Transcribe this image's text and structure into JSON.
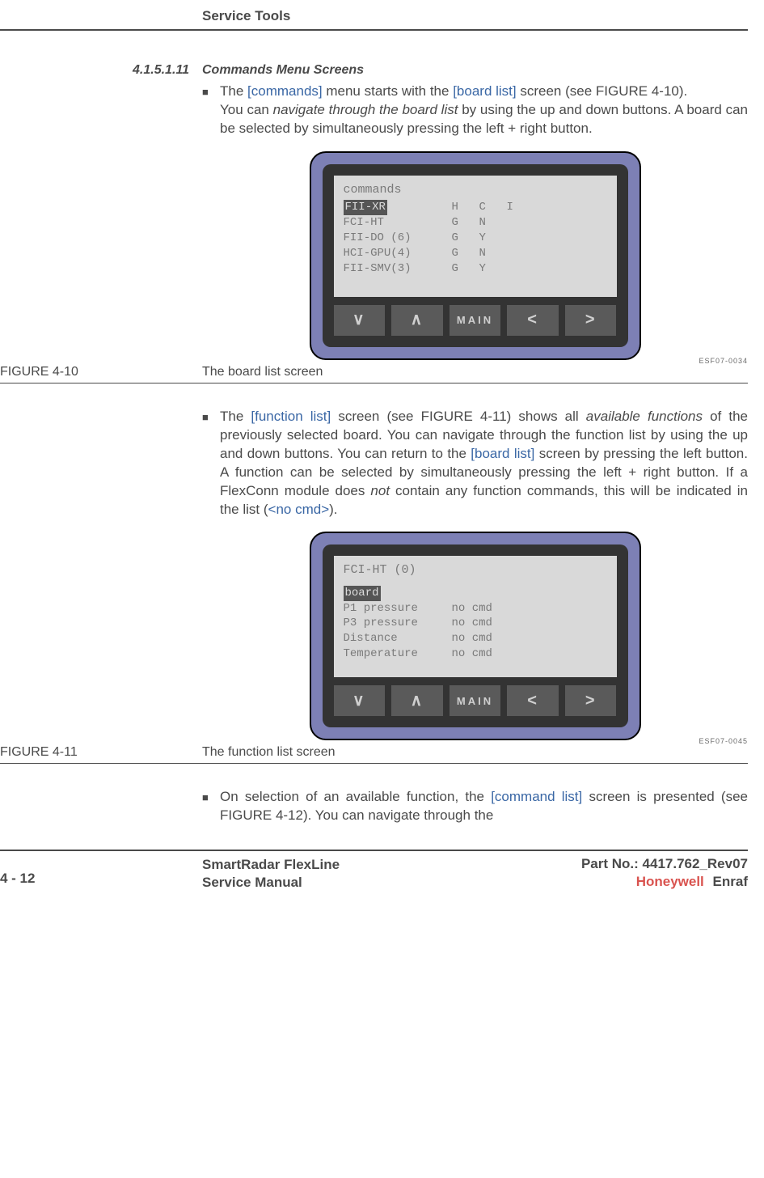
{
  "header": {
    "section": "Service Tools"
  },
  "section": {
    "number": "4.1.5.1.11",
    "title": "Commands Menu Screens"
  },
  "bullets": {
    "b1_pre": "The ",
    "b1_ref1": "[commands]",
    "b1_mid1": " menu starts with the ",
    "b1_ref2": "[board list]",
    "b1_mid2": " screen (see FIGURE 4-10).",
    "b1_line2a": "You can ",
    "b1_line2i": "navigate through the board list",
    "b1_line2b": " by using the up and down buttons. A board can be selected by simultaneously pressing the left + right button.",
    "b2_pre": "The ",
    "b2_ref1": "[function list]",
    "b2_mid1": " screen (see FIGURE 4-11) shows all ",
    "b2_i1": "available functions",
    "b2_mid2": " of the previously selected board. You can navigate through the function list by using the up and down buttons. You can return to the ",
    "b2_ref2": "[board list]",
    "b2_mid3": " screen by pressing the left button. A function can be selected by simultaneously pressing the left + right button. If a FlexConn module does ",
    "b2_i2": "not",
    "b2_mid4": " contain any function commands, this will be indicated in the list (",
    "b2_ref3": "<no cmd>",
    "b2_mid5": ").",
    "b3_pre": "On selection of an available function, the ",
    "b3_ref1": "[command list]",
    "b3_mid1": " screen is presented (see FIGURE 4-12). You can navigate through the"
  },
  "figures": {
    "f1": {
      "label": "FIGURE  4-10",
      "caption": "The board list screen",
      "code": "ESF07-0034"
    },
    "f2": {
      "label": "FIGURE  4-11",
      "caption": "The function list screen",
      "code": "ESF07-0045"
    }
  },
  "device1": {
    "title": "commands",
    "rows": [
      {
        "c1": "FII-XR",
        "c2": "H",
        "c3": "C",
        "c4": "I",
        "hl": true
      },
      {
        "c1": "FCI-HT",
        "c2": "G",
        "c3": "N",
        "c4": ""
      },
      {
        "c1": "FII-DO (6)",
        "c2": "G",
        "c3": "Y",
        "c4": ""
      },
      {
        "c1": "HCI-GPU(4)",
        "c2": "G",
        "c3": "N",
        "c4": ""
      },
      {
        "c1": "FII-SMV(3)",
        "c2": "G",
        "c3": "Y",
        "c4": ""
      }
    ]
  },
  "device2": {
    "title": "FCI-HT (0)",
    "rows": [
      {
        "c1": "board",
        "c2": "",
        "hl": true
      },
      {
        "c1": "P1 pressure",
        "c2": "no cmd"
      },
      {
        "c1": "P3 pressure",
        "c2": "no cmd"
      },
      {
        "c1": "Distance",
        "c2": "no cmd"
      },
      {
        "c1": "Temperature",
        "c2": "no cmd"
      }
    ]
  },
  "buttons": {
    "down": "∨",
    "up": "∧",
    "main": "MAIN",
    "left": "<",
    "right": ">"
  },
  "footer": {
    "page": "4 - 12",
    "product": "SmartRadar FlexLine",
    "manual": "Service Manual",
    "part": "Part No.: 4417.762_Rev07",
    "brand1": "Honeywell",
    "brand2": "Enraf"
  }
}
